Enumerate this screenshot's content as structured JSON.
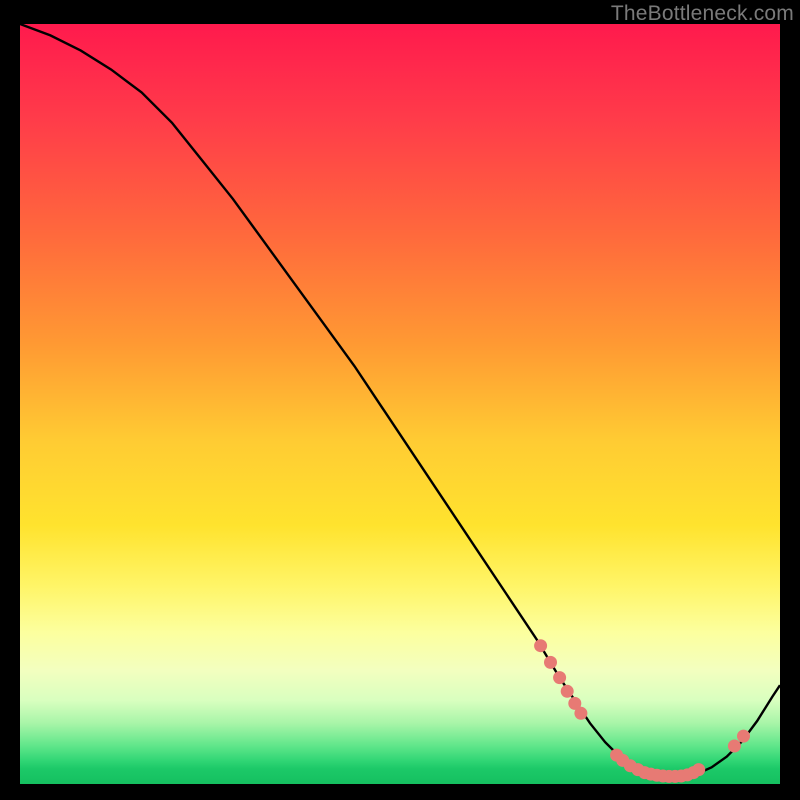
{
  "watermark": "TheBottleneck.com",
  "colors": {
    "background": "#000000",
    "gradient_top": "#ff1a4d",
    "gradient_bottom": "#15c060",
    "curve": "#000000",
    "dots": "#e77a74"
  },
  "chart_data": {
    "type": "line",
    "title": "",
    "xlabel": "",
    "ylabel": "",
    "xlim": [
      0,
      100
    ],
    "ylim": [
      0,
      100
    ],
    "series": [
      {
        "name": "curve",
        "x": [
          0,
          4,
          8,
          12,
          16,
          20,
          24,
          28,
          32,
          36,
          40,
          44,
          48,
          52,
          56,
          60,
          64,
          68,
          71,
          73,
          75,
          77,
          79,
          81,
          83,
          85,
          87,
          89,
          91,
          93,
          95,
          97,
          99,
          100
        ],
        "y": [
          100,
          98.5,
          96.5,
          94,
          91,
          87,
          82,
          77,
          71.5,
          66,
          60.5,
          55,
          49,
          43,
          37,
          31,
          25,
          19,
          14,
          11,
          8,
          5.5,
          3.5,
          2,
          1.3,
          1,
          1,
          1.3,
          2.2,
          3.6,
          5.6,
          8.3,
          11.5,
          13
        ]
      }
    ],
    "points": [
      {
        "x": 68.5,
        "y": 18.2
      },
      {
        "x": 69.8,
        "y": 16.0
      },
      {
        "x": 71.0,
        "y": 14.0
      },
      {
        "x": 72.0,
        "y": 12.2
      },
      {
        "x": 73.0,
        "y": 10.6
      },
      {
        "x": 73.8,
        "y": 9.3
      },
      {
        "x": 78.5,
        "y": 3.8
      },
      {
        "x": 79.3,
        "y": 3.1
      },
      {
        "x": 80.3,
        "y": 2.4
      },
      {
        "x": 81.3,
        "y": 1.9
      },
      {
        "x": 82.2,
        "y": 1.5
      },
      {
        "x": 83.0,
        "y": 1.3
      },
      {
        "x": 83.8,
        "y": 1.15
      },
      {
        "x": 84.6,
        "y": 1.05
      },
      {
        "x": 85.4,
        "y": 1.0
      },
      {
        "x": 86.2,
        "y": 1.0
      },
      {
        "x": 87.0,
        "y": 1.05
      },
      {
        "x": 87.8,
        "y": 1.2
      },
      {
        "x": 88.6,
        "y": 1.5
      },
      {
        "x": 89.3,
        "y": 1.9
      },
      {
        "x": 94.0,
        "y": 5.0
      },
      {
        "x": 95.2,
        "y": 6.3
      }
    ]
  }
}
